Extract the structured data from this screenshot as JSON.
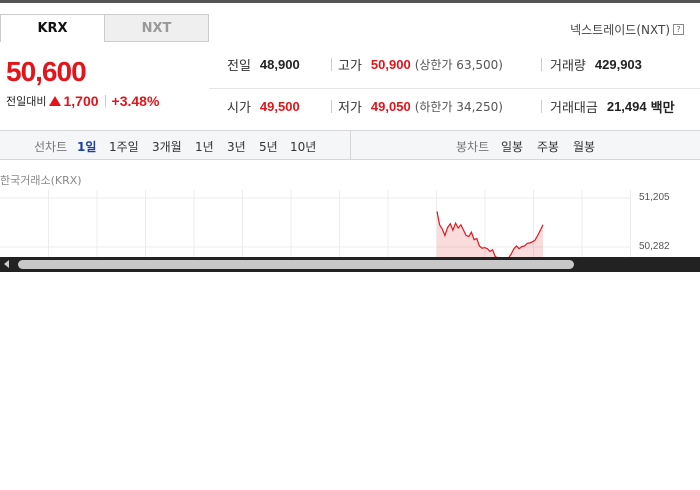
{
  "tabs": [
    {
      "label": "KRX",
      "active": true
    },
    {
      "label": "NXT",
      "active": false
    }
  ],
  "nxt_link": {
    "label": "넥스트레이드(NXT)",
    "help_icon": "question-box-icon"
  },
  "price": {
    "current": "50,600",
    "change_label": "전일대비",
    "change": "1,700",
    "change_pct": "+3.48%",
    "direction": "up"
  },
  "stats": {
    "prev_close": {
      "label": "전일",
      "value": "48,900"
    },
    "high": {
      "label": "고가",
      "value": "50,900",
      "sub": "(상한가 63,500)"
    },
    "volume": {
      "label": "거래량",
      "value": "429,903"
    },
    "open": {
      "label": "시가",
      "value": "49,500"
    },
    "low": {
      "label": "저가",
      "value": "49,050",
      "sub": "(하한가 34,250)"
    },
    "trade_amount": {
      "label": "거래대금",
      "value": "21,494",
      "unit": "백만"
    }
  },
  "chart_controls": {
    "line_label": "선차트",
    "line_periods": [
      "1일",
      "1주일",
      "3개월",
      "1년",
      "3년",
      "5년",
      "10년"
    ],
    "active_period": "1일",
    "candle_label": "봉차트",
    "candle_periods": [
      "일봉",
      "주봉",
      "월봉"
    ]
  },
  "exchange_label": "한국거래소(KRX)",
  "colors": {
    "up": "#e3141a",
    "active": "#1a3ea8"
  },
  "chart_data": {
    "type": "area",
    "y_ticks": [
      "51,205",
      "50,282"
    ],
    "ylim": [
      49900,
      51400
    ],
    "x": [
      0,
      1,
      2,
      3,
      4,
      5,
      6,
      7,
      8,
      9,
      10,
      11,
      12,
      13,
      14,
      15,
      16,
      17,
      18,
      19,
      20,
      21,
      22,
      23,
      24,
      25,
      26,
      27,
      28,
      29,
      30,
      31,
      32,
      33,
      34,
      35,
      36,
      37,
      38,
      39,
      40
    ],
    "values": [
      50950,
      50700,
      50620,
      50500,
      50650,
      50720,
      50600,
      50730,
      50640,
      50700,
      50600,
      50500,
      50480,
      50560,
      50420,
      50440,
      50300,
      50260,
      50270,
      50250,
      50200,
      50230,
      50100,
      50080,
      50020,
      50050,
      50020,
      50080,
      50150,
      50250,
      50300,
      50250,
      50290,
      50300,
      50350,
      50360,
      50380,
      50410,
      50500,
      50600,
      50700
    ]
  }
}
